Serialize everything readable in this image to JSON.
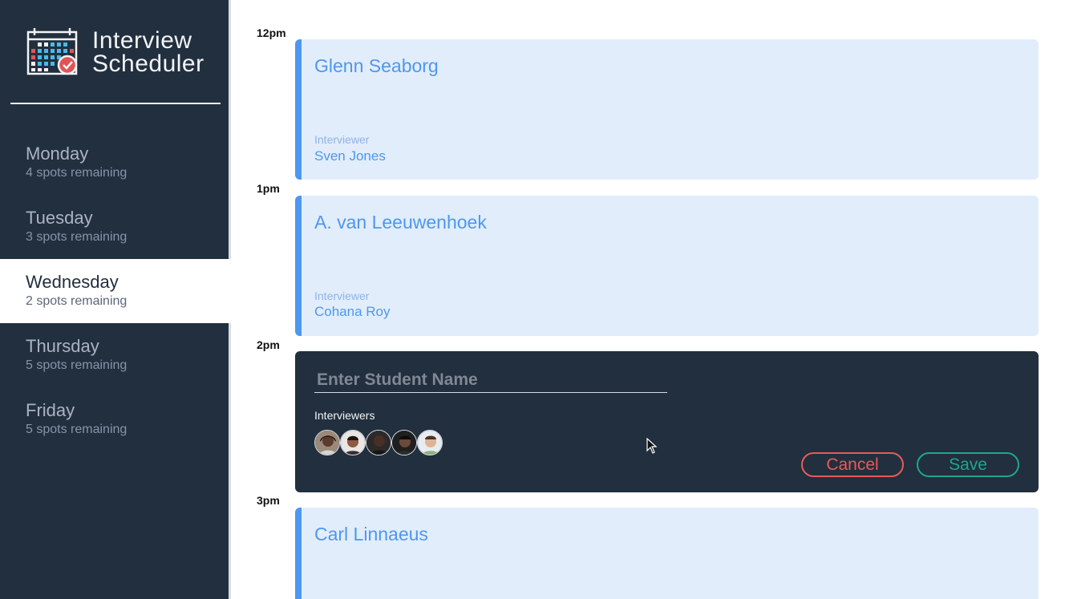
{
  "app": {
    "title_line1": "Interview",
    "title_line2": "Scheduler",
    "logo_icon": "calendar-check-icon"
  },
  "days": [
    {
      "name": "Monday",
      "spots": "4 spots remaining",
      "selected": false
    },
    {
      "name": "Tuesday",
      "spots": "3 spots remaining",
      "selected": false
    },
    {
      "name": "Wednesday",
      "spots": "2 spots remaining",
      "selected": true
    },
    {
      "name": "Thursday",
      "spots": "5 spots remaining",
      "selected": false
    },
    {
      "name": "Friday",
      "spots": "5 spots remaining",
      "selected": false
    }
  ],
  "times": [
    "12pm",
    "1pm",
    "2pm",
    "3pm"
  ],
  "appointments": [
    {
      "time": "12pm",
      "student": "Glenn Seaborg",
      "interviewer_label": "Interviewer",
      "interviewer": "Sven Jones"
    },
    {
      "time": "1pm",
      "student": "A. van Leeuwenhoek",
      "interviewer_label": "Interviewer",
      "interviewer": "Cohana Roy"
    },
    {
      "time": "3pm",
      "student": "Carl Linnaeus"
    }
  ],
  "form": {
    "student_placeholder": "Enter Student Name",
    "student_value": "",
    "interviewers_label": "Interviewers",
    "interviewer_avatars": [
      "avatar-1",
      "avatar-2",
      "avatar-3",
      "avatar-4",
      "avatar-5"
    ],
    "cancel_label": "Cancel",
    "save_label": "Save"
  },
  "colors": {
    "sidebar_bg": "#222f3e",
    "appointment_bg": "#e2edfb",
    "accent_blue": "#4d97f0",
    "cancel_red": "#e85a5a",
    "save_green": "#1ea68a"
  }
}
